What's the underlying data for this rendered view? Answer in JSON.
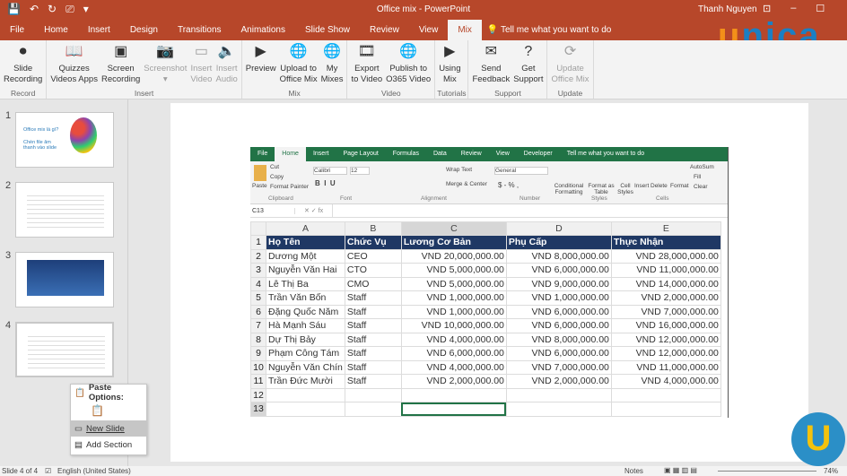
{
  "window": {
    "title": "Office mix - PowerPoint",
    "user": "Thanh Nguyen",
    "qat": [
      "💾",
      "↶",
      "↻",
      "⎚",
      "▾"
    ],
    "controls": [
      "⊡",
      "–",
      "☐"
    ]
  },
  "tabs": [
    "File",
    "Home",
    "Insert",
    "Design",
    "Transitions",
    "Animations",
    "Slide Show",
    "Review",
    "View",
    "Mix"
  ],
  "active_tab": "Mix",
  "tell_me": "Tell me what you want to do",
  "logo": {
    "u": "u",
    "rest": "nica"
  },
  "ribbon": [
    {
      "group": "Record",
      "buttons": [
        {
          "l1": "Slide",
          "l2": "Recording",
          "icon": "⏺"
        }
      ]
    },
    {
      "group": "Insert",
      "buttons": [
        {
          "l1": "Quizzes",
          "l2": "Videos Apps",
          "icon": "📖"
        },
        {
          "l1": "Screen",
          "l2": "Recording",
          "icon": "▣"
        },
        {
          "l1": "Screenshot",
          "l2": "▾",
          "icon": "📷",
          "dis": true
        },
        {
          "l1": "Insert",
          "l2": "Video",
          "icon": "▭",
          "dis": true
        },
        {
          "l1": "Insert",
          "l2": "Audio",
          "icon": "🔈",
          "dis": true
        }
      ]
    },
    {
      "group": "Mix",
      "buttons": [
        {
          "l1": "Preview",
          "l2": "",
          "icon": "▶"
        },
        {
          "l1": "Upload to",
          "l2": "Office Mix",
          "icon": "🌐"
        },
        {
          "l1": "My",
          "l2": "Mixes",
          "icon": "🌐"
        }
      ]
    },
    {
      "group": "Video",
      "buttons": [
        {
          "l1": "Export",
          "l2": "to Video",
          "icon": "🎞"
        },
        {
          "l1": "Publish to",
          "l2": "O365 Video",
          "icon": "🌐"
        }
      ]
    },
    {
      "group": "Tutorials",
      "buttons": [
        {
          "l1": "Using",
          "l2": "Mix",
          "icon": "▶"
        }
      ]
    },
    {
      "group": "Support",
      "buttons": [
        {
          "l1": "Send",
          "l2": "Feedback",
          "icon": "✉"
        },
        {
          "l1": "Get",
          "l2": "Support",
          "icon": "?"
        }
      ]
    },
    {
      "group": "Update",
      "buttons": [
        {
          "l1": "Update",
          "l2": "Office Mix",
          "icon": "⟳",
          "dis": true
        }
      ]
    }
  ],
  "slides": [
    {
      "num": "1",
      "line1": "Office mix là gì?",
      "line2": "Chèn file âm thanh vào slide"
    },
    {
      "num": "2"
    },
    {
      "num": "3"
    },
    {
      "num": "4"
    }
  ],
  "context_menu": {
    "paste_options": "Paste Options:",
    "new_slide": "New Slide",
    "add_section": "Add Section"
  },
  "excel": {
    "tabs": [
      "File",
      "Home",
      "Insert",
      "Page Layout",
      "Formulas",
      "Data",
      "Review",
      "View",
      "Developer"
    ],
    "tell_me": "Tell me what you want to do",
    "ribbon": {
      "cut": "Cut",
      "copy": "Copy",
      "format_painter": "Format Painter",
      "paste": "Paste",
      "font": "Calibri",
      "size": "12",
      "wrap": "Wrap Text",
      "merge": "Merge & Center",
      "number_format": "General",
      "cond": "Conditional Formatting",
      "table": "Format as Table",
      "styles": "Cell Styles",
      "insert": "Insert",
      "delete": "Delete",
      "format": "Format",
      "autosum": "AutoSum",
      "fill": "Fill",
      "clear": "Clear",
      "groups": [
        "Clipboard",
        "Font",
        "Alignment",
        "Number",
        "Styles",
        "Cells"
      ]
    },
    "name_box": "C13",
    "columns": [
      "A",
      "B",
      "C",
      "D",
      "E"
    ],
    "header": [
      "Họ Tên",
      "Chức Vụ",
      "Lương Cơ Bản",
      "Phụ Cấp",
      "Thực Nhận"
    ],
    "rows": [
      [
        "Dương Một",
        "CEO",
        "VND 20,000,000.00",
        "VND 8,000,000.00",
        "VND 28,000,000.00"
      ],
      [
        "Nguyễn Văn Hai",
        "CTO",
        "VND 5,000,000.00",
        "VND 6,000,000.00",
        "VND 11,000,000.00"
      ],
      [
        "Lê Thị Ba",
        "CMO",
        "VND 5,000,000.00",
        "VND 9,000,000.00",
        "VND 14,000,000.00"
      ],
      [
        "Trần Văn Bốn",
        "Staff",
        "VND 1,000,000.00",
        "VND 1,000,000.00",
        "VND 2,000,000.00"
      ],
      [
        "Đặng Quốc Năm",
        "Staff",
        "VND 1,000,000.00",
        "VND 6,000,000.00",
        "VND 7,000,000.00"
      ],
      [
        "Hà Mạnh Sáu",
        "Staff",
        "VND 10,000,000.00",
        "VND 6,000,000.00",
        "VND 16,000,000.00"
      ],
      [
        "Dự Thị Bảy",
        "Staff",
        "VND 4,000,000.00",
        "VND 8,000,000.00",
        "VND 12,000,000.00"
      ],
      [
        "Phạm Công Tám",
        "Staff",
        "VND 6,000,000.00",
        "VND 6,000,000.00",
        "VND 12,000,000.00"
      ],
      [
        "Nguyễn Văn Chín",
        "Staff",
        "VND 4,000,000.00",
        "VND 7,000,000.00",
        "VND 11,000,000.00"
      ],
      [
        "Trần Đức Mười",
        "Staff",
        "VND 2,000,000.00",
        "VND 2,000,000.00",
        "VND 4,000,000.00"
      ]
    ],
    "row_numbers": [
      "1",
      "2",
      "3",
      "4",
      "5",
      "6",
      "7",
      "8",
      "9",
      "10",
      "11",
      "12",
      "13"
    ]
  },
  "status": {
    "slide": "Slide 4 of 4",
    "language": "English (United States)",
    "notes": "Notes",
    "zoom": "74%"
  },
  "badge": "U"
}
